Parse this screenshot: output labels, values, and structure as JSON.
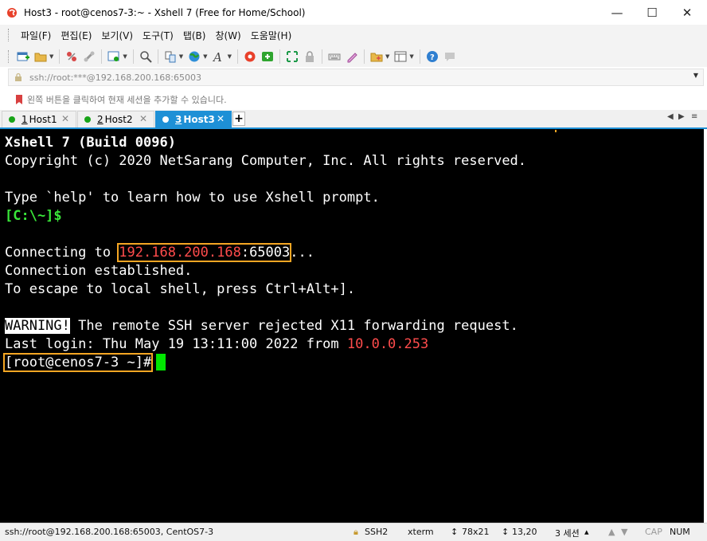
{
  "window": {
    "title": "Host3 - root@cenos7-3:~ - Xshell 7 (Free for Home/School)",
    "minimize": "—",
    "maximize": "☐",
    "close": "✕"
  },
  "menu": [
    "파일(F)",
    "편집(E)",
    "보기(V)",
    "도구(T)",
    "탭(B)",
    "창(W)",
    "도움말(H)"
  ],
  "address": {
    "value": "ssh://root:***@192.168.200.168:65003"
  },
  "hint": "왼쪽 버튼을 클릭하여 현재 세션을 추가할 수 있습니다.",
  "tabs": [
    {
      "num": "1",
      "label": "Host1"
    },
    {
      "num": "2",
      "label": "Host2"
    },
    {
      "num": "3",
      "label": "Host3"
    }
  ],
  "tab_add": "+",
  "terminal": {
    "l1": "Xshell 7 (Build 0096)",
    "l2": "Copyright (c) 2020 NetSarang Computer, Inc. All rights reserved.",
    "l3": "Type `help' to learn how to use Xshell prompt.",
    "l4": "[C:\\~]$",
    "l5a": "Connecting to ",
    "l5ip": "192.168.200.168",
    "l5port": ":65003",
    "l5b": "...",
    "l6": "Connection established.",
    "l7": "To escape to local shell, press Ctrl+Alt+].",
    "l8warn": "WARNING!",
    "l8": " The remote SSH server rejected X11 forwarding request.",
    "l9a": "Last login: Thu May 19 13:11:00 2022 from ",
    "l9ip": "10.0.0.253",
    "l10": "[root@cenos7-3 ~]#"
  },
  "status": {
    "session": "ssh://root@192.168.200.168:65003, CentOS7-3",
    "protocol": "SSH2",
    "term": "xterm",
    "size": "78x21",
    "pos": "13,20",
    "sessions": "3 세션",
    "cap": "CAP",
    "num": "NUM"
  },
  "colors": {
    "accent": "#1e90d6",
    "prompt_green": "#39e639",
    "ip_red": "#ff4c4c",
    "highlight_orange": "#f5a623"
  }
}
